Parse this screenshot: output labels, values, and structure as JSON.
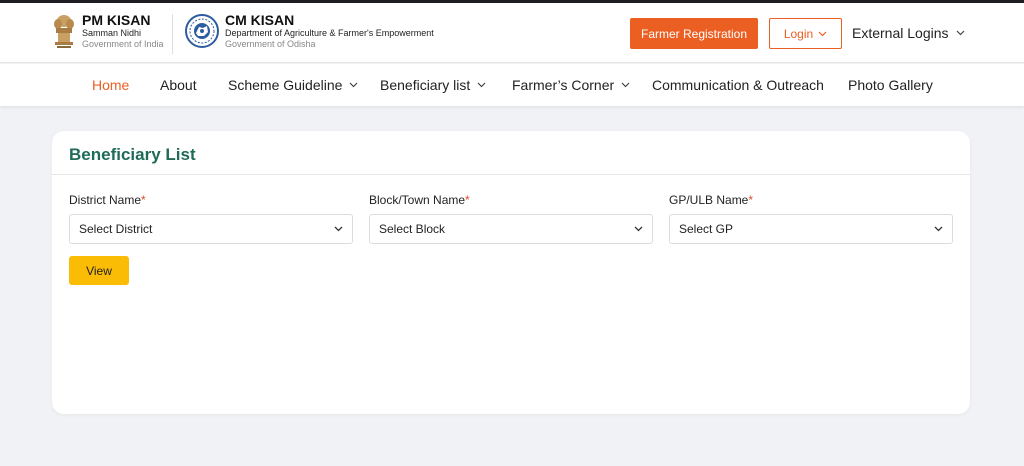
{
  "header": {
    "pm_kisan": {
      "title": "PM KISAN",
      "subtitle": "Samman Nidhi",
      "org": "Government of India"
    },
    "cm_kisan": {
      "title": "CM KISAN",
      "subtitle": "Department of Agriculture & Farmer's Empowerment",
      "org": "Government of Odisha"
    },
    "farmer_registration_label": "Farmer Registration",
    "login_label": "Login",
    "external_logins_label": "External Logins"
  },
  "nav": {
    "items": [
      {
        "label": "Home",
        "active": true
      },
      {
        "label": "About"
      },
      {
        "label": "Scheme Guideline",
        "dropdown": true
      },
      {
        "label": "Beneficiary list",
        "dropdown": true
      },
      {
        "label": "Farmer’s Corner",
        "dropdown": true
      },
      {
        "label": "Communication & Outreach"
      },
      {
        "label": "Photo Gallery"
      }
    ]
  },
  "form": {
    "title": "Beneficiary List",
    "required_mark": "*",
    "district": {
      "label": "District Name",
      "value": "Select District"
    },
    "block": {
      "label": "Block/Town Name",
      "value": "Select Block"
    },
    "gp": {
      "label": "GP/ULB Name",
      "value": "Select GP"
    },
    "view_label": "View"
  },
  "colors": {
    "accent": "#eb5f23",
    "title_green": "#1f6b58",
    "view_button": "#fbbc05"
  }
}
